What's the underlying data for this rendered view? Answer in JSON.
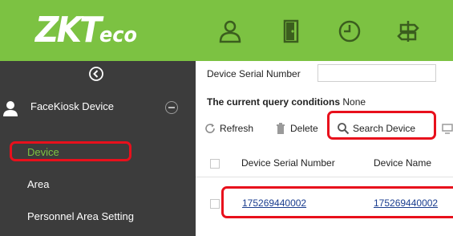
{
  "header": {
    "logo_text": "ZKT",
    "logo_suffix": "eco",
    "nav_icons": [
      "personnel-icon",
      "door-icon",
      "clock-icon",
      "signpost-icon"
    ],
    "accent_color": "#7cc242"
  },
  "sidebar": {
    "collapse_icon": "chevron-left-circle-icon",
    "module": {
      "label": "FaceKiosk Device",
      "icon": "person-icon"
    },
    "items": [
      {
        "label": "Device",
        "active": true
      },
      {
        "label": "Area",
        "active": false
      },
      {
        "label": "Personnel Area Setting",
        "active": false
      }
    ]
  },
  "filter": {
    "label": "Device Serial Number",
    "value": ""
  },
  "query": {
    "label": "The current query conditions",
    "value": "None"
  },
  "toolbar": {
    "refresh_label": "Refresh",
    "delete_label": "Delete",
    "search_device_label": "Search Device"
  },
  "table": {
    "columns": [
      "Device Serial Number",
      "Device Name"
    ],
    "rows": [
      {
        "serial": "175269440002",
        "name": "175269440002"
      }
    ]
  },
  "highlight_color": "#e8101c"
}
